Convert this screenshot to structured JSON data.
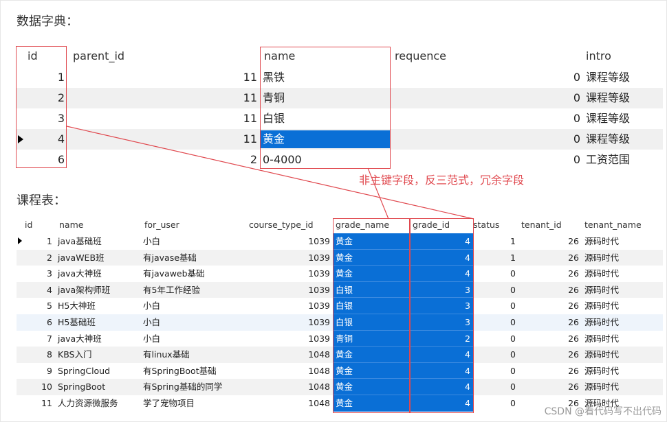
{
  "heading_dictionary": "数据字典：",
  "heading_course": "课程表：",
  "annotation": "非主键字段，反三范式，冗余字段",
  "watermark": "CSDN @看代码写不出代码",
  "colors": {
    "selection": "#0a6fd6",
    "highlight_red": "#e0484e"
  },
  "dict_table": {
    "columns": [
      "id",
      "parent_id",
      "name",
      "requence",
      "intro"
    ],
    "rows": [
      [
        "1",
        "11",
        "黑铁",
        "0",
        "课程等级"
      ],
      [
        "2",
        "11",
        "青铜",
        "0",
        "课程等级"
      ],
      [
        "3",
        "11",
        "白银",
        "0",
        "课程等级"
      ],
      [
        "4",
        "11",
        "黄金",
        "0",
        "课程等级"
      ],
      [
        "6",
        "2",
        "0-4000",
        "0",
        "工资范围"
      ]
    ],
    "current_row_index": 3,
    "selected_cell": {
      "row": 3,
      "column": "name"
    }
  },
  "course_table": {
    "columns": [
      "id",
      "name",
      "for_user",
      "course_type_id",
      "grade_name",
      "grade_id",
      "status",
      "tenant_id",
      "tenant_name"
    ],
    "rows": [
      [
        "1",
        "java基础班",
        "小白",
        "1039",
        "黄金",
        "4",
        "1",
        "26",
        "源码时代"
      ],
      [
        "2",
        "javaWEB班",
        "有javase基础",
        "1039",
        "黄金",
        "4",
        "1",
        "26",
        "源码时代"
      ],
      [
        "3",
        "java大神班",
        "有javaweb基础",
        "1039",
        "黄金",
        "4",
        "0",
        "26",
        "源码时代"
      ],
      [
        "4",
        "java架构师班",
        "有5年工作经验",
        "1039",
        "白银",
        "3",
        "0",
        "26",
        "源码时代"
      ],
      [
        "5",
        "H5大神班",
        "小白",
        "1039",
        "白银",
        "3",
        "0",
        "26",
        "源码时代"
      ],
      [
        "6",
        "H5基础班",
        "小白",
        "1039",
        "白银",
        "3",
        "0",
        "26",
        "源码时代"
      ],
      [
        "7",
        "java大神班",
        "小白",
        "1039",
        "青铜",
        "2",
        "0",
        "26",
        "源码时代"
      ],
      [
        "8",
        "KBS入门",
        "有linux基础",
        "1048",
        "黄金",
        "4",
        "0",
        "26",
        "源码时代"
      ],
      [
        "9",
        "SpringCloud",
        "有SpringBoot基础",
        "1048",
        "黄金",
        "4",
        "0",
        "26",
        "源码时代"
      ],
      [
        "10",
        "SpringBoot",
        "有Spring基础的同学",
        "1048",
        "黄金",
        "4",
        "0",
        "26",
        "源码时代"
      ],
      [
        "11",
        "人力资源微服务",
        "学了宠物项目",
        "1048",
        "黄金",
        "4",
        "0",
        "26",
        "源码时代"
      ]
    ],
    "current_row_index": 0,
    "highlighted_row_index": 5,
    "selected_columns": [
      "grade_name",
      "grade_id"
    ]
  }
}
